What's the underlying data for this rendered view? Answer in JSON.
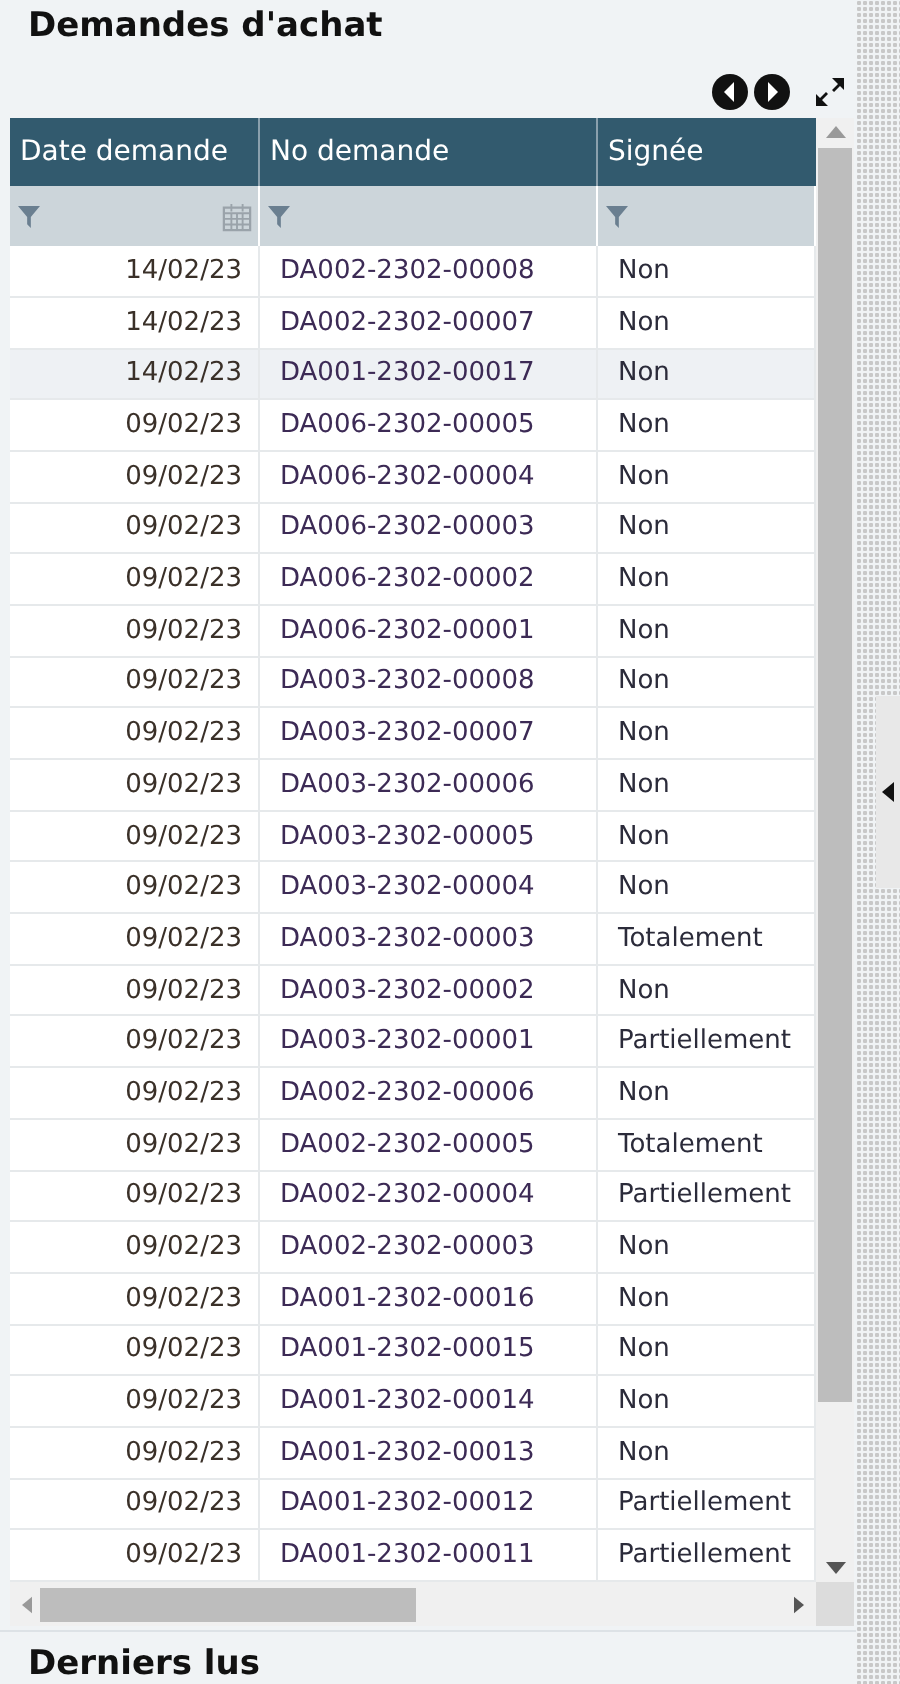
{
  "title": "Demandes d'achat",
  "table": {
    "columns": [
      "Date demande",
      "No demande",
      "Signée"
    ],
    "rows": [
      {
        "date": "14/02/23",
        "number": "DA002-2302-00008",
        "signed": "Non",
        "selected": false
      },
      {
        "date": "14/02/23",
        "number": "DA002-2302-00007",
        "signed": "Non",
        "selected": false
      },
      {
        "date": "14/02/23",
        "number": "DA001-2302-00017",
        "signed": "Non",
        "selected": true
      },
      {
        "date": "09/02/23",
        "number": "DA006-2302-00005",
        "signed": "Non",
        "selected": false
      },
      {
        "date": "09/02/23",
        "number": "DA006-2302-00004",
        "signed": "Non",
        "selected": false
      },
      {
        "date": "09/02/23",
        "number": "DA006-2302-00003",
        "signed": "Non",
        "selected": false
      },
      {
        "date": "09/02/23",
        "number": "DA006-2302-00002",
        "signed": "Non",
        "selected": false
      },
      {
        "date": "09/02/23",
        "number": "DA006-2302-00001",
        "signed": "Non",
        "selected": false
      },
      {
        "date": "09/02/23",
        "number": "DA003-2302-00008",
        "signed": "Non",
        "selected": false
      },
      {
        "date": "09/02/23",
        "number": "DA003-2302-00007",
        "signed": "Non",
        "selected": false
      },
      {
        "date": "09/02/23",
        "number": "DA003-2302-00006",
        "signed": "Non",
        "selected": false
      },
      {
        "date": "09/02/23",
        "number": "DA003-2302-00005",
        "signed": "Non",
        "selected": false
      },
      {
        "date": "09/02/23",
        "number": "DA003-2302-00004",
        "signed": "Non",
        "selected": false
      },
      {
        "date": "09/02/23",
        "number": "DA003-2302-00003",
        "signed": "Totalement",
        "selected": false
      },
      {
        "date": "09/02/23",
        "number": "DA003-2302-00002",
        "signed": "Non",
        "selected": false
      },
      {
        "date": "09/02/23",
        "number": "DA003-2302-00001",
        "signed": "Partiellement",
        "selected": false
      },
      {
        "date": "09/02/23",
        "number": "DA002-2302-00006",
        "signed": "Non",
        "selected": false
      },
      {
        "date": "09/02/23",
        "number": "DA002-2302-00005",
        "signed": "Totalement",
        "selected": false
      },
      {
        "date": "09/02/23",
        "number": "DA002-2302-00004",
        "signed": "Partiellement",
        "selected": false
      },
      {
        "date": "09/02/23",
        "number": "DA002-2302-00003",
        "signed": "Non",
        "selected": false
      },
      {
        "date": "09/02/23",
        "number": "DA001-2302-00016",
        "signed": "Non",
        "selected": false
      },
      {
        "date": "09/02/23",
        "number": "DA001-2302-00015",
        "signed": "Non",
        "selected": false
      },
      {
        "date": "09/02/23",
        "number": "DA001-2302-00014",
        "signed": "Non",
        "selected": false
      },
      {
        "date": "09/02/23",
        "number": "DA001-2302-00013",
        "signed": "Non",
        "selected": false
      },
      {
        "date": "09/02/23",
        "number": "DA001-2302-00012",
        "signed": "Partiellement",
        "selected": false
      },
      {
        "date": "09/02/23",
        "number": "DA001-2302-00011",
        "signed": "Partiellement",
        "selected": false
      }
    ]
  },
  "next_section": {
    "title": "Derniers lus"
  }
}
